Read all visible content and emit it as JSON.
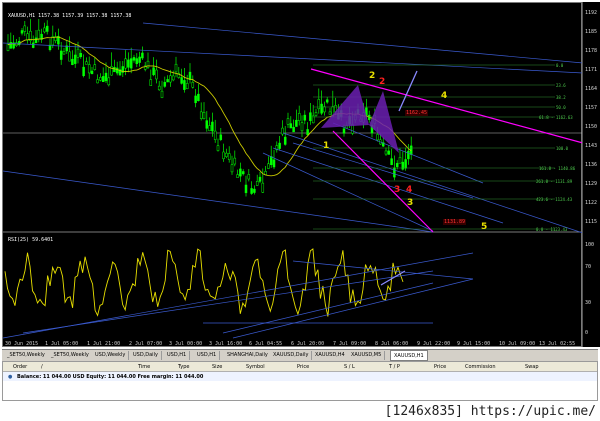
{
  "chart": {
    "symbol_ohlc": "XAUUSD,H1  1157.38 1157.39 1157.38 1157.38",
    "rsi_label": "RSI(25) 59.6401",
    "price_scale": [
      "1192",
      "1185",
      "1178",
      "1171",
      "1164",
      "1157",
      "1150",
      "1143",
      "1136",
      "1129",
      "1122",
      "1115"
    ],
    "rsi_scale": [
      "100",
      "70",
      "30",
      "0"
    ],
    "time_labels": [
      "30 Jun 2015",
      "1 Jul 05:00",
      "1 Jul 21:00",
      "2 Jul 07:00",
      "3 Jul 00:00",
      "3 Jul 16:00",
      "6 Jul 04:55",
      "6 Jul 20:00",
      "7 Jul 09:00",
      "8 Jul 06:00",
      "9 Jul 22:00",
      "9 Jul 15:00",
      "10 Jul 09:00",
      "13 Jul 02:55"
    ],
    "wave_labels": [
      {
        "text": "1",
        "color": "y"
      },
      {
        "text": "2",
        "color": "y"
      },
      {
        "text": "2",
        "color": "r"
      },
      {
        "text": "3",
        "color": "r"
      },
      {
        "text": "4",
        "color": "y"
      },
      {
        "text": "5",
        "color": "y"
      },
      {
        "text": "3",
        "color": "y"
      },
      {
        "text": "4",
        "color": "r"
      }
    ],
    "red_tags": [
      "1162.45",
      "1131.89"
    ],
    "fib_levels": [
      "0.0",
      "23.6",
      "38.2",
      "50.0",
      "61.8 - 1162.63",
      "100.0",
      "161.8 - 1140.86",
      "261.8 - 1131.89",
      "423.6 - 1124.43",
      "0.0 - 1123.43"
    ],
    "colors": {
      "background": "#000000",
      "bull_candle": "#00ff00",
      "ma_line": "#c8c800",
      "trend_lines": "#3a5acf",
      "magenta_lines": "#ff00ff",
      "fib_lines": "#2f8f2f",
      "rsi_line": "#e8e000"
    }
  },
  "tabs": [
    {
      "label": "_SET50,Weekly",
      "active": false
    },
    {
      "label": "_SET50,Weekly",
      "active": false
    },
    {
      "label": "USD,Weekly",
      "active": false
    },
    {
      "label": "USD,Daily",
      "active": false
    },
    {
      "label": "USD,H1",
      "active": false
    },
    {
      "label": "USD,H1",
      "active": false
    },
    {
      "label": "SHANGHAI,Daily",
      "active": false
    },
    {
      "label": "XAUUSD,Daily",
      "active": false
    },
    {
      "label": "XAUUSD,H4",
      "active": false
    },
    {
      "label": "XAUUSD,M5",
      "active": false
    },
    {
      "label": "XAUUSD,H1",
      "active": true
    }
  ],
  "terminal": {
    "columns": [
      "Order",
      "/",
      "Time",
      "Type",
      "Size",
      "Symbol",
      "Price",
      "S / L",
      "T / P",
      "Price",
      "Commission",
      "Swap"
    ],
    "balance_text": "Balance: 11 044.00 USD  Equity: 11 044.00  Free margin: 11 044.00"
  },
  "watermark": "[1246x835] https://upic.me/"
}
